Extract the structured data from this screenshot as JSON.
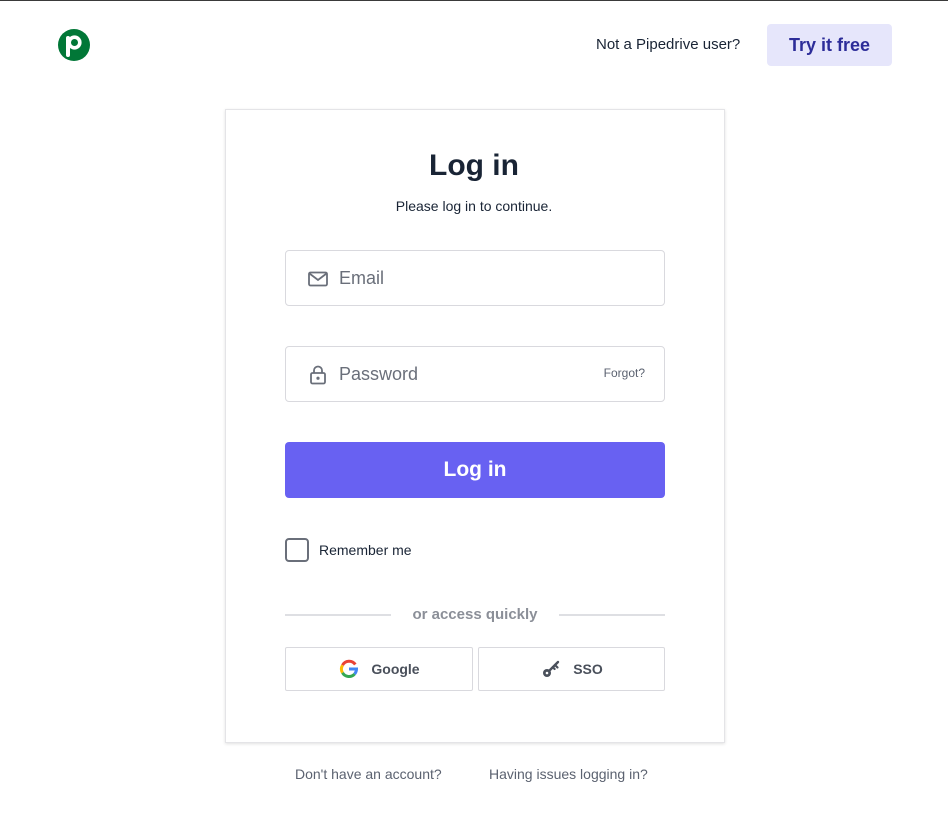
{
  "header": {
    "logo_icon": "pipedrive-logo-icon",
    "question": "Not a Pipedrive user?",
    "try_label": "Try it free"
  },
  "login": {
    "title": "Log in",
    "subtitle": "Please log in to continue.",
    "email": {
      "placeholder": "Email",
      "value": "",
      "icon": "envelope-icon"
    },
    "password": {
      "placeholder": "Password",
      "value": "",
      "icon": "lock-icon"
    },
    "forgot_label": "Forgot?",
    "submit_label": "Log in",
    "remember_label": "Remember me",
    "remember_checked": false,
    "divider_text": "or access quickly",
    "google_label": "Google",
    "sso_label": "SSO"
  },
  "footer": {
    "signup_link": "Don't have an account?",
    "issues_link": "Having issues logging in?"
  },
  "colors": {
    "brand_green": "#017737",
    "primary_button": "#6861f2",
    "try_button_bg": "#e6e6fb",
    "try_button_text": "#2d2d99"
  }
}
